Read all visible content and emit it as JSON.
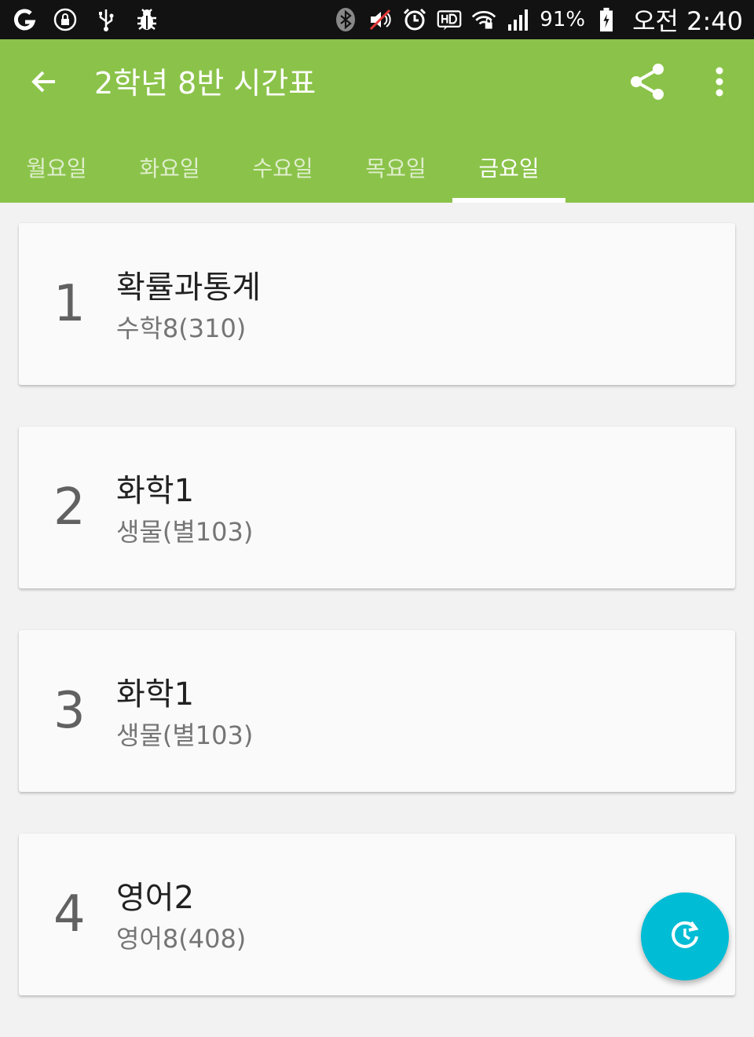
{
  "status_bar": {
    "battery_percent": "91%",
    "time": "오전 2:40",
    "icons": [
      "carrier-g-icon",
      "lock-icon",
      "usb-icon",
      "bug-icon",
      "bluetooth-icon",
      "mute-icon",
      "alarm-icon",
      "hd-icon",
      "wifi-icon",
      "signal-icon",
      "battery-charging-icon"
    ]
  },
  "app_bar": {
    "title": "2학년 8반 시간표",
    "background_color": "#8bc34a",
    "icons": [
      "back-arrow-icon",
      "share-icon",
      "more-vert-icon"
    ]
  },
  "tabs": [
    {
      "label": "월요일",
      "selected": false
    },
    {
      "label": "화요일",
      "selected": false
    },
    {
      "label": "수요일",
      "selected": false
    },
    {
      "label": "목요일",
      "selected": false
    },
    {
      "label": "금요일",
      "selected": true
    }
  ],
  "periods": [
    {
      "number": "1",
      "subject": "확률과통계",
      "room": "수학8(310)"
    },
    {
      "number": "2",
      "subject": "화학1",
      "room": "생물(별103)"
    },
    {
      "number": "3",
      "subject": "화학1",
      "room": "생물(별103)"
    },
    {
      "number": "4",
      "subject": "영어2",
      "room": "영어8(408)"
    }
  ],
  "fab": {
    "icon": "schedule-refresh-icon",
    "color": "#00bcd4"
  }
}
